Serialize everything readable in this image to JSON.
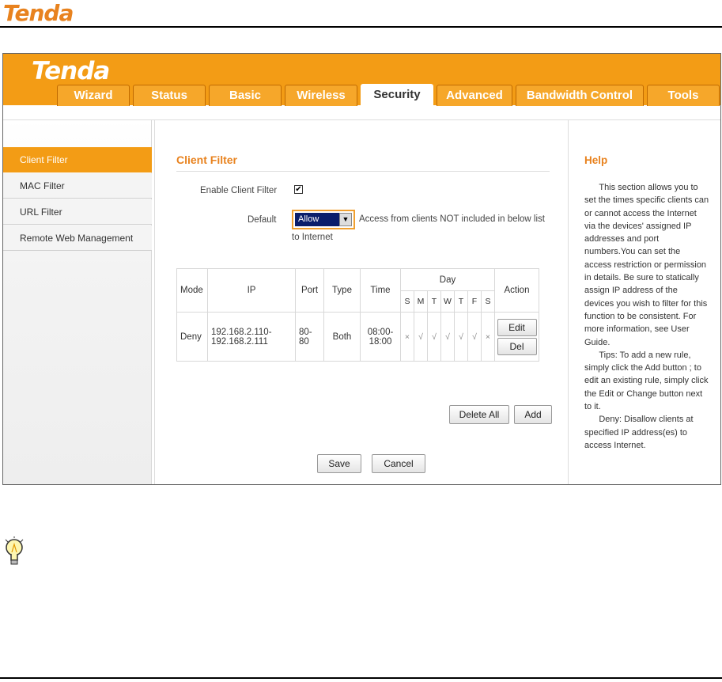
{
  "doc": {
    "brand": "Tenda"
  },
  "app": {
    "brand": "Tenda",
    "tabs": [
      "Wizard",
      "Status",
      "Basic",
      "Wireless",
      "Security",
      "Advanced",
      "Bandwidth Control",
      "Tools"
    ],
    "active_tab": "Security"
  },
  "sidebar": {
    "items": [
      "Client Filter",
      "MAC Filter",
      "URL Filter",
      "Remote Web Management"
    ],
    "active": "Client Filter"
  },
  "main": {
    "title": "Client Filter",
    "enable_label": "Enable Client Filter",
    "enable_checked": "✔",
    "default_label": "Default",
    "default_value": "Allow",
    "default_desc_1": "Access from clients NOT included in below list",
    "default_desc_2": "to Internet",
    "table": {
      "headers": {
        "mode": "Mode",
        "ip": "IP",
        "port": "Port",
        "type": "Type",
        "time": "Time",
        "day": "Day",
        "action": "Action"
      },
      "days": [
        "S",
        "M",
        "T",
        "W",
        "T",
        "F",
        "S"
      ],
      "row": {
        "mode": "Deny",
        "ip_1": "192.168.2.110-",
        "ip_2": "192.168.2.111",
        "port_1": "80-",
        "port_2": "80",
        "type": "Both",
        "time_1": "08:00-",
        "time_2": "18:00",
        "days": [
          "×",
          "√",
          "√",
          "√",
          "√",
          "√",
          "×"
        ],
        "edit": "Edit",
        "del": "Del"
      }
    },
    "delete_all": "Delete All",
    "add": "Add",
    "save": "Save",
    "cancel": "Cancel"
  },
  "help": {
    "title": "Help",
    "text": "      This section allows you to set the times specific clients can or cannot access the Internet via the devices' assigned IP addresses and port numbers.You can set the access restriction or permission in details. Be sure to statically assign IP address of the devices you wish to filter for this function to be consistent. For more information, see User Guide.\n      Tips: To add a new rule, simply click the Add button ; to edit an existing rule, simply click the Edit or Change button next to it.\n      Deny: Disallow clients at specified IP address(es) to access Internet."
  },
  "colors": {
    "brand_orange": "#f39c15",
    "title_orange": "#e8821e",
    "select_blue": "#0a1e6b"
  }
}
